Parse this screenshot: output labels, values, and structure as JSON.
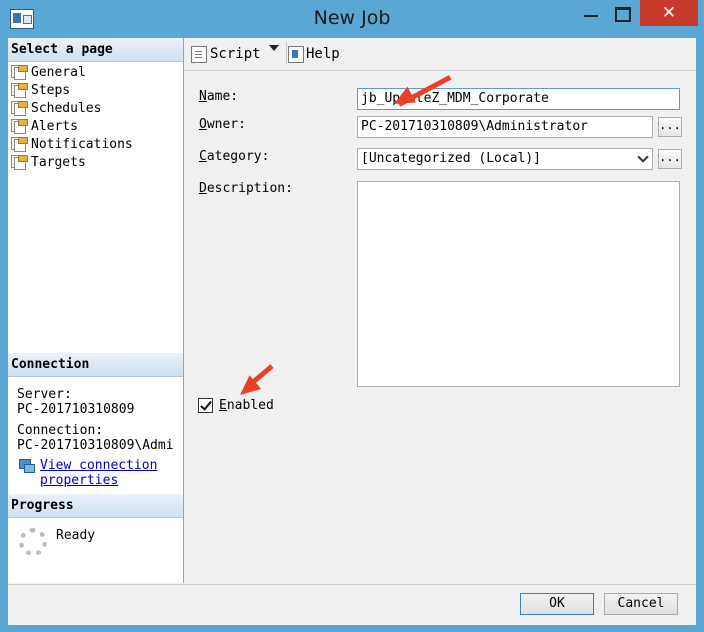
{
  "window": {
    "title": "New Job",
    "close_glyph": "✕"
  },
  "sidebar": {
    "select_page_header": "Select a page",
    "items": [
      {
        "label": "General"
      },
      {
        "label": "Steps"
      },
      {
        "label": "Schedules"
      },
      {
        "label": "Alerts"
      },
      {
        "label": "Notifications"
      },
      {
        "label": "Targets"
      }
    ],
    "connection": {
      "header": "Connection",
      "server_label": "Server:",
      "server_value": "PC-201710310809",
      "connection_label": "Connection:",
      "connection_value": "PC-201710310809\\Admi",
      "view_link_line1": "View connection",
      "view_link_line2": "properties"
    },
    "progress": {
      "header": "Progress",
      "status": "Ready"
    }
  },
  "toolbar": {
    "script_label": "Script",
    "help_label": "Help"
  },
  "form": {
    "name_label_u": "N",
    "name_label_rest": "ame:",
    "name_value": "jb_UpdateZ_MDM_Corporate",
    "owner_label_u": "O",
    "owner_label_rest": "wner:",
    "owner_value": "PC-201710310809\\Administrator",
    "category_label_u": "C",
    "category_label_rest": "ategory:",
    "category_value": "[Uncategorized (Local)]",
    "description_label_u": "D",
    "description_label_rest": "escription:",
    "description_value": "",
    "browse_label": "...",
    "enabled_label_u": "E",
    "enabled_label_rest": "nabled",
    "enabled_checked": true
  },
  "buttons": {
    "ok_label": "OK",
    "cancel_label": "Cancel"
  },
  "colors": {
    "title_bar": "#5aa6d4",
    "close_button": "#c9392b",
    "annotation_arrow": "#e8402c",
    "link": "#0000cc"
  }
}
